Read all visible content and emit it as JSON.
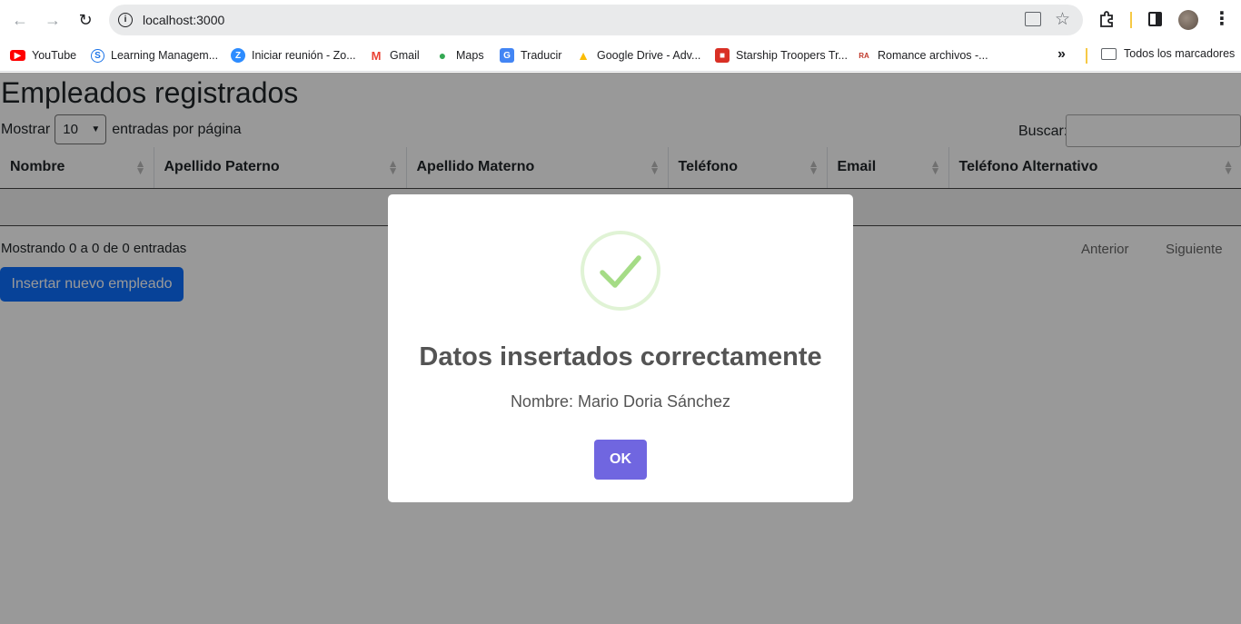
{
  "browser": {
    "url": "localhost:3000",
    "bookmarks": [
      {
        "label": "YouTube",
        "icon": "youtube-icon",
        "color": "#ff0000"
      },
      {
        "label": "Learning Managem...",
        "icon": "learning-icon",
        "color": "#1a73e8"
      },
      {
        "label": "Iniciar reunión - Zo...",
        "icon": "zoom-icon",
        "color": "#2d8cff"
      },
      {
        "label": "Gmail",
        "icon": "gmail-icon",
        "color": "#ea4335"
      },
      {
        "label": "Maps",
        "icon": "maps-icon",
        "color": "#34a853"
      },
      {
        "label": "Traducir",
        "icon": "translate-icon",
        "color": "#4285f4"
      },
      {
        "label": "Google Drive - Adv...",
        "icon": "drive-icon",
        "color": "#fbbc04"
      },
      {
        "label": "Starship Troopers Tr...",
        "icon": "film-icon",
        "color": "#d93025"
      },
      {
        "label": "Romance archivos -...",
        "icon": "site-icon",
        "color": "#c0392b"
      }
    ],
    "all_bookmarks": "Todos los marcadores"
  },
  "page": {
    "title": "Empleados registrados",
    "length_prefix": "Mostrar",
    "length_value": "10",
    "length_suffix": "entradas por página",
    "search_label": "Buscar:",
    "columns": [
      "Nombre",
      "Apellido Paterno",
      "Apellido Materno",
      "Teléfono",
      "Email",
      "Teléfono Alternativo"
    ],
    "info": "Mostrando 0 a 0 de 0 entradas",
    "prev": "Anterior",
    "next": "Siguiente",
    "insert_button": "Insertar nuevo empleado"
  },
  "modal": {
    "title": "Datos insertados correctamente",
    "text": "Nombre: Mario Doria Sánchez",
    "ok": "OK",
    "icon": "success-check-icon"
  },
  "colors": {
    "primary": "#0d6efd",
    "confirm": "#7066e0",
    "success": "#a5dc86"
  }
}
